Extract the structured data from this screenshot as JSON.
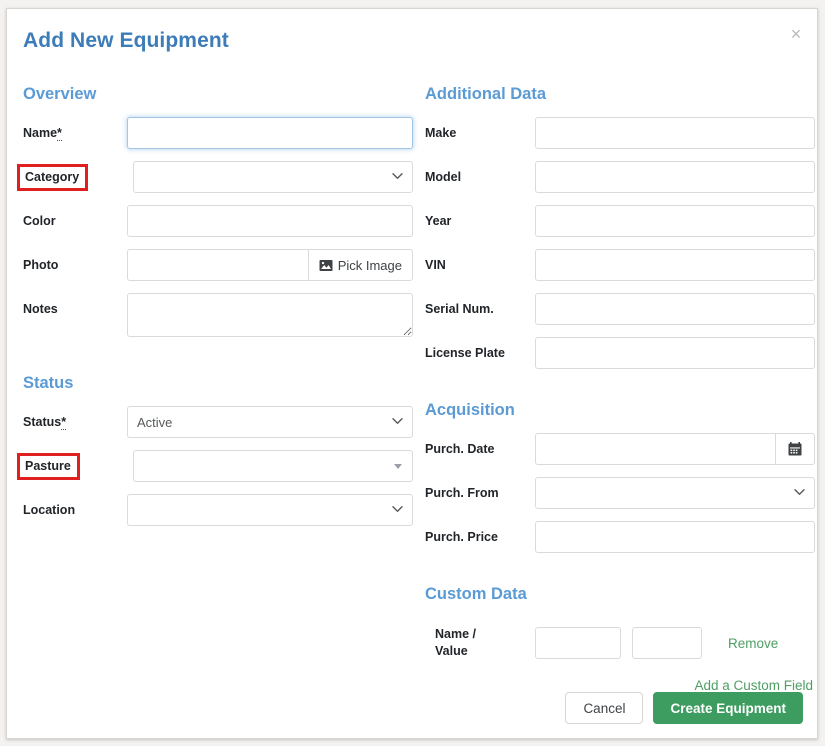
{
  "dialog": {
    "title": "Add New Equipment",
    "close_label": "×"
  },
  "overview": {
    "heading": "Overview",
    "fields": {
      "name": {
        "label": "Name",
        "required_mark": "*",
        "value": "",
        "placeholder": ""
      },
      "category": {
        "label": "Category",
        "value": "",
        "highlighted": true
      },
      "color": {
        "label": "Color",
        "value": "",
        "placeholder": ""
      },
      "photo": {
        "label": "Photo",
        "value": "",
        "placeholder": "",
        "button_label": "Pick Image",
        "button_icon": "image-icon"
      },
      "notes": {
        "label": "Notes",
        "value": "",
        "placeholder": ""
      }
    }
  },
  "status": {
    "heading": "Status",
    "fields": {
      "status": {
        "label": "Status",
        "required_mark": "*",
        "value": "Active"
      },
      "pasture": {
        "label": "Pasture",
        "value": "",
        "highlighted": true
      },
      "location": {
        "label": "Location",
        "value": ""
      }
    }
  },
  "additional_data": {
    "heading": "Additional Data",
    "fields": {
      "make": {
        "label": "Make",
        "value": ""
      },
      "model": {
        "label": "Model",
        "value": ""
      },
      "year": {
        "label": "Year",
        "value": ""
      },
      "vin": {
        "label": "VIN",
        "value": ""
      },
      "serial_num": {
        "label": "Serial Num.",
        "value": ""
      },
      "license_plate": {
        "label": "License Plate",
        "value": ""
      }
    }
  },
  "acquisition": {
    "heading": "Acquisition",
    "fields": {
      "purch_date": {
        "label": "Purch. Date",
        "value": "",
        "button_icon": "calendar-icon"
      },
      "purch_from": {
        "label": "Purch. From",
        "value": ""
      },
      "purch_price": {
        "label": "Purch. Price",
        "value": ""
      }
    }
  },
  "custom_data": {
    "heading": "Custom Data",
    "row_label": "Name /\nValue",
    "row_label_line1": "Name /",
    "row_label_line2": "Value",
    "name_value": "",
    "value_value": "",
    "remove_label": "Remove",
    "add_label": "Add a Custom Field"
  },
  "footer": {
    "cancel_label": "Cancel",
    "submit_label": "Create Equipment"
  },
  "colors": {
    "title_blue": "#3c7cb8",
    "heading_blue": "#5b9bd5",
    "highlight_red": "#e02020",
    "link_green": "#4e9f63",
    "submit_green": "#3d9c5f",
    "input_border": "#d9dadb",
    "focus_border": "#a3c6e4"
  }
}
